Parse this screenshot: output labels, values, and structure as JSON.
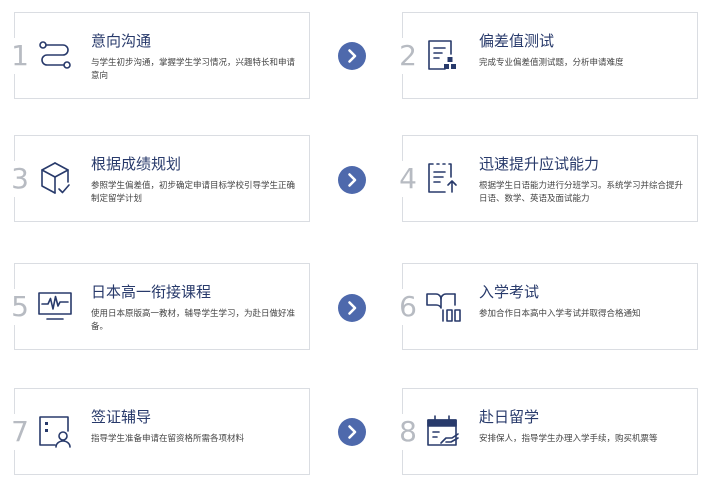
{
  "steps": [
    {
      "num": "1",
      "title": "意向沟通",
      "desc": "与学生初步沟通，掌握学生学习情况，兴趣特长和申请意向",
      "icon": "route-icon"
    },
    {
      "num": "2",
      "title": "偏差值测试",
      "desc": "完成专业偏差值测试题，分析申请难度",
      "icon": "test-sheet-icon"
    },
    {
      "num": "3",
      "title": "根据成绩规划",
      "desc": "参照学生偏差值，初步确定申请目标学校引导学生正确制定留学计划",
      "icon": "box-check-icon"
    },
    {
      "num": "4",
      "title": "迅速提升应试能力",
      "desc": "根据学生日语能力进行分班学习。系统学习并综合提升日语、数学、英语及面试能力",
      "icon": "progress-doc-icon"
    },
    {
      "num": "5",
      "title": "日本高一衔接课程",
      "desc": "使用日本原版高一教材，辅导学生学习，为赴日做好准备。",
      "icon": "monitor-icon"
    },
    {
      "num": "6",
      "title": "入学考试",
      "desc": "参加合作日本高中入学考试并取得合格通知",
      "icon": "book-score-icon"
    },
    {
      "num": "7",
      "title": "签证辅导",
      "desc": "指导学生准备申请在留资格所需各项材料",
      "icon": "id-card-icon"
    },
    {
      "num": "8",
      "title": "赴日留学",
      "desc": "安排保人，指导学生办理入学手续，购买机票等",
      "icon": "calendar-hand-icon"
    }
  ],
  "arrow_icon": "chevron-right-icon",
  "colors": {
    "accent": "#4e69ac",
    "title": "#283a6b",
    "number": "#b7bbc2",
    "border": "#dadde2",
    "text": "#444444"
  }
}
